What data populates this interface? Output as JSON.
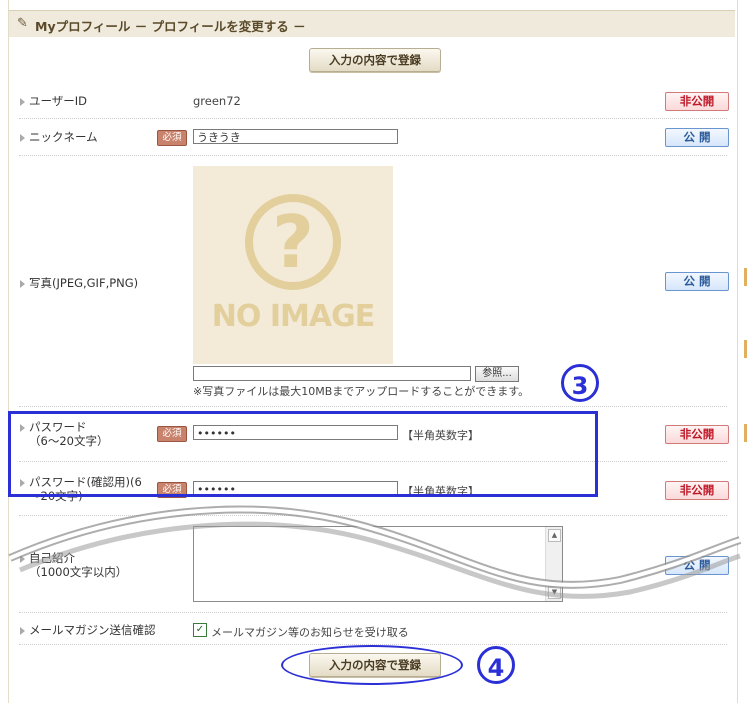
{
  "header": {
    "title": "Myプロフィール － プロフィールを変更する －"
  },
  "submit_label": "入力の内容で登録",
  "rows": {
    "userid": {
      "label": "ユーザーID",
      "value": "green72",
      "visibility": "非公開"
    },
    "nickname": {
      "label": "ニックネーム",
      "required": "必須",
      "value": "うきうき",
      "visibility": "公 開"
    },
    "photo": {
      "label": "写真(JPEG,GIF,PNG)",
      "no_image": "NO IMAGE",
      "browse": "参照...",
      "note": "※写真ファイルは最大10MBまでアップロードすることができます。",
      "visibility": "公 開"
    },
    "password": {
      "label1": "パスワード",
      "label2": "（6～20文字）",
      "required": "必須",
      "value": "••••••",
      "hint": "【半角英数字】",
      "visibility": "非公開"
    },
    "password_confirm": {
      "label1": "パスワード(確認用)(6",
      "label2": "～20文字)",
      "required": "必須",
      "value": "••••••",
      "hint": "【半角英数字】",
      "visibility": "非公開"
    },
    "intro": {
      "label1": "自己紹介",
      "label2": "（1000文字以内）",
      "visibility": "公 開"
    },
    "magazine": {
      "label": "メールマガジン送信確認",
      "checkbox_label": "メールマガジン等のお知らせを受け取る",
      "checked": true
    }
  },
  "annotations": {
    "step3": "3",
    "step4": "4"
  },
  "colors": {
    "accent_blue": "#2b2fd6",
    "private_red": "#c01a2a",
    "public_blue": "#2a5a9a"
  }
}
